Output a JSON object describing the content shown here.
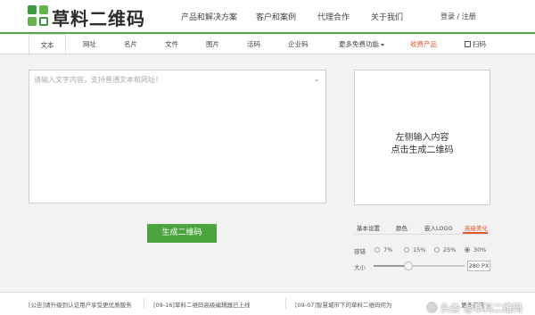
{
  "header": {
    "brand": "草料二维码",
    "nav": [
      "产品和解决方案",
      "客户和案例",
      "代理合作",
      "关于我们"
    ],
    "login": "登录 / 注册"
  },
  "tabs": {
    "items": [
      "文本",
      "网址",
      "名片",
      "文件",
      "图片",
      "活码",
      "企业码"
    ],
    "more": "更多免费功能",
    "paid": "收费产品",
    "scan": "扫码"
  },
  "editor": {
    "placeholder": "请输入文字内容，支持普通文本和网址！",
    "generate": "生成二维码"
  },
  "preview": {
    "line1": "左侧输入内容",
    "line2": "点击生成二维码"
  },
  "settings": {
    "tabs": [
      "基本设置",
      "颜色",
      "嵌入LOGO",
      "高级美化"
    ],
    "active_tab": 3,
    "tolerance_label": "容错",
    "tolerance_options": [
      "7%",
      "15%",
      "25%",
      "30%"
    ],
    "tolerance_selected": "30%",
    "size_label": "大小",
    "size_value": "280 PX",
    "size_slider_fraction": 0.38
  },
  "footer": {
    "news": [
      "[公告]请升级到认证用户享受更优质服务",
      "[09-16]草料二维码高级编辑器已上线",
      "[09-07]智慧城市下的草料二维码何为",
      "更多资讯 >"
    ],
    "watermark": "头条 @草料二维码"
  },
  "colors": {
    "brand_green": "#4ca43e",
    "accent_orange": "#e4572e"
  }
}
